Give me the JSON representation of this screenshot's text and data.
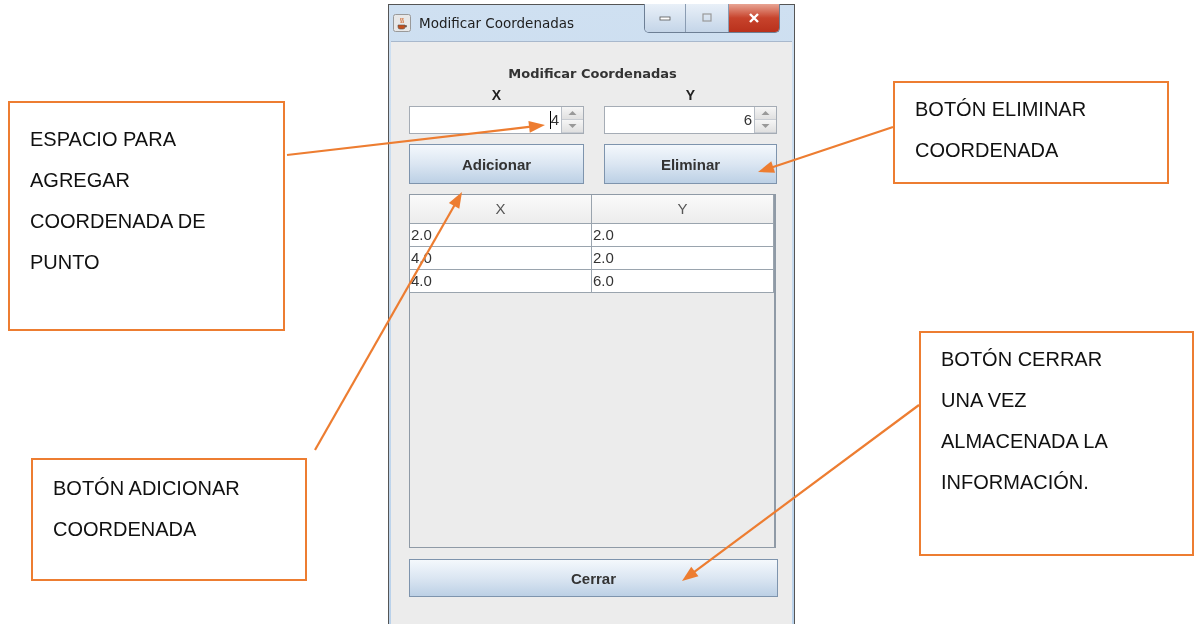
{
  "window": {
    "title": "Modificar Coordenadas"
  },
  "heading": "Modificar Coordenadas",
  "spinners": [
    {
      "label": "X",
      "value": "4",
      "focused": true
    },
    {
      "label": "Y",
      "value": "6",
      "focused": false
    }
  ],
  "buttons": [
    "Adicionar",
    "Eliminar"
  ],
  "table": {
    "columns": [
      "X",
      "Y"
    ],
    "rows": [
      [
        "2.0",
        "2.0"
      ],
      [
        "4.0",
        "2.0"
      ],
      [
        "4.0",
        "6.0"
      ]
    ]
  },
  "close_button": "Cerrar",
  "callouts": [
    {
      "lines": [
        "ESPACIO PARA",
        "AGREGAR",
        "COORDENADA DE",
        "PUNTO"
      ]
    },
    {
      "lines": [
        "BOTÓN ELIMINAR",
        "COORDENADA"
      ]
    },
    {
      "lines": [
        "BOTÓN ADICIONAR",
        "COORDENADA"
      ]
    },
    {
      "lines": [
        "BOTÓN CERRAR",
        "UNA VEZ",
        "ALMACENADA LA",
        "INFORMACIÓN."
      ]
    }
  ]
}
